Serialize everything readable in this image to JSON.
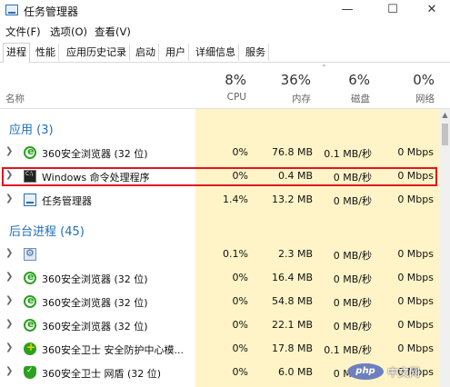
{
  "window": {
    "title": "任务管理器"
  },
  "menu": [
    "文件(F)",
    "选项(O)",
    "查看(V)"
  ],
  "tabs": [
    "进程",
    "性能",
    "应用历史记录",
    "启动",
    "用户",
    "详细信息",
    "服务"
  ],
  "active_tab": "进程",
  "columns": {
    "name": "名称",
    "cpu": {
      "pct": "8%",
      "label": "CPU"
    },
    "mem": {
      "pct": "36%",
      "label": "内存"
    },
    "disk": {
      "pct": "6%",
      "label": "磁盘"
    },
    "net": {
      "pct": "0%",
      "label": "网络"
    }
  },
  "groups": {
    "apps": "应用 (3)",
    "background": "后台进程 (45)"
  },
  "apps": [
    {
      "name": "360安全浏览器 (32 位)",
      "icon": "browser-icon",
      "cpu": "0%",
      "mem": "76.8 MB",
      "disk": "0.1 MB/秒",
      "net": "0 Mbps"
    },
    {
      "name": "Windows 命令处理程序",
      "icon": "cmd-icon",
      "cpu": "0%",
      "mem": "0.4 MB",
      "disk": "0 MB/秒",
      "net": "0 Mbps"
    },
    {
      "name": "任务管理器",
      "icon": "task-manager-icon",
      "cpu": "1.4%",
      "mem": "13.2 MB",
      "disk": "0 MB/秒",
      "net": "0 Mbps"
    }
  ],
  "background": [
    {
      "name": "",
      "icon": "gear-icon",
      "cpu": "0.1%",
      "mem": "2.3 MB",
      "disk": "0 MB/秒",
      "net": "0 Mbps"
    },
    {
      "name": "360安全浏览器 (32 位)",
      "icon": "browser-icon",
      "cpu": "0%",
      "mem": "16.4 MB",
      "disk": "0 MB/秒",
      "net": "0 Mbps"
    },
    {
      "name": "360安全浏览器 (32 位)",
      "icon": "browser-icon",
      "cpu": "0%",
      "mem": "54.8 MB",
      "disk": "0 MB/秒",
      "net": "0 Mbps"
    },
    {
      "name": "360安全浏览器 (32 位)",
      "icon": "browser-icon",
      "cpu": "0%",
      "mem": "22.1 MB",
      "disk": "0 MB/秒",
      "net": "0 Mbps"
    },
    {
      "name": "360安全卫士 安全防护中心模...",
      "icon": "security-guard-icon",
      "cpu": "0%",
      "mem": "17.8 MB",
      "disk": "0.1 MB/秒",
      "net": "0 Mbps"
    },
    {
      "name": "360安全卫士 网盾 (32 位)",
      "icon": "shield-icon",
      "cpu": "0%",
      "mem": "6.0 MB",
      "disk": "0 MB/秒",
      "net": "0 Mbps"
    }
  ],
  "watermark": {
    "logo": "php",
    "text": "中文网"
  },
  "colors": {
    "group_header": "#1f6fb5",
    "column_highlight": "#fff4c7",
    "selection_border": "#e0151f"
  }
}
